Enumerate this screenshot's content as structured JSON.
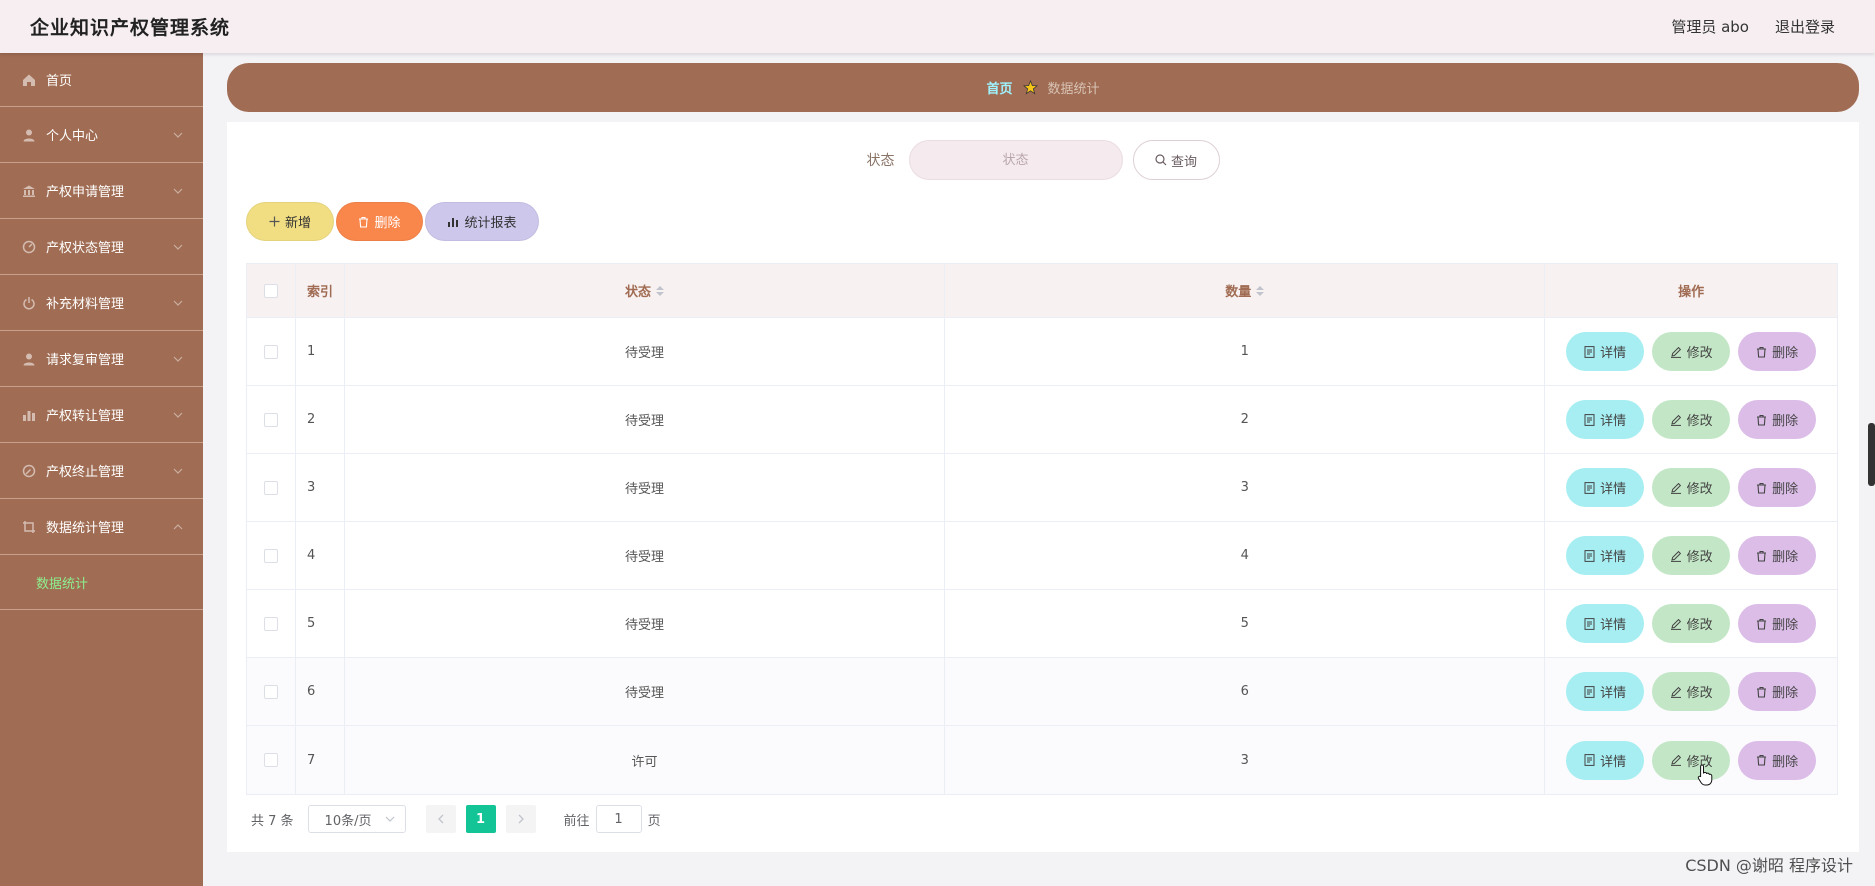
{
  "header": {
    "app_title": "企业知识产权管理系统",
    "user_label": "管理员 abo",
    "logout_label": "退出登录"
  },
  "sidebar": {
    "items": [
      {
        "label": "首页",
        "icon": "home-icon"
      },
      {
        "label": "个人中心",
        "icon": "user-icon"
      },
      {
        "label": "产权申请管理",
        "icon": "bank-icon"
      },
      {
        "label": "产权状态管理",
        "icon": "dashboard-icon"
      },
      {
        "label": "补充材料管理",
        "icon": "power-icon"
      },
      {
        "label": "请求复审管理",
        "icon": "user-icon"
      },
      {
        "label": "产权转让管理",
        "icon": "bar-chart-icon"
      },
      {
        "label": "产权终止管理",
        "icon": "compass-icon"
      },
      {
        "label": "数据统计管理",
        "icon": "crop-icon"
      }
    ],
    "submenu": {
      "label": "数据统计"
    }
  },
  "breadcrumb": {
    "home": "首页",
    "current": "数据统计"
  },
  "search": {
    "label": "状态",
    "placeholder": "状态",
    "query_label": "查询"
  },
  "actions": {
    "add_label": "新增",
    "delete_label": "删除",
    "stats_label": "统计报表"
  },
  "table": {
    "headers": {
      "index": "索引",
      "state": "状态",
      "quantity": "数量",
      "operations": "操作"
    },
    "rows": [
      {
        "index": "1",
        "state": "待受理",
        "quantity": "1"
      },
      {
        "index": "2",
        "state": "待受理",
        "quantity": "2"
      },
      {
        "index": "3",
        "state": "待受理",
        "quantity": "3"
      },
      {
        "index": "4",
        "state": "待受理",
        "quantity": "4"
      },
      {
        "index": "5",
        "state": "待受理",
        "quantity": "5"
      },
      {
        "index": "6",
        "state": "待受理",
        "quantity": "6"
      },
      {
        "index": "7",
        "state": "许可",
        "quantity": "3"
      }
    ],
    "op_labels": {
      "detail": "详情",
      "edit": "修改",
      "remove": "删除"
    }
  },
  "pagination": {
    "total": "共 7 条",
    "page_size": "10条/页",
    "current_page": "1",
    "goto_prefix": "前往",
    "goto_value": "1",
    "goto_suffix": "页"
  },
  "watermark": "CSDN @谢昭 程序设计",
  "colors": {
    "sidebar": "#a06c53",
    "active_submenu": "#8ef08f",
    "page_active": "#13c596"
  }
}
